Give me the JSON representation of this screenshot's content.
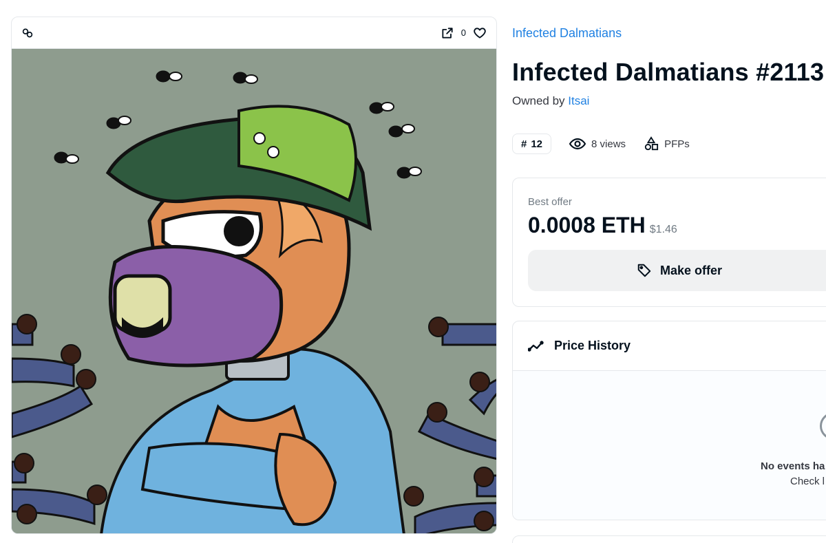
{
  "media": {
    "chain_icon": "chain-link-icon",
    "external_icon": "external-link-icon",
    "favorite_icon": "heart-icon",
    "favorite_count": "0",
    "background_color": "#8e9c8e"
  },
  "item": {
    "collection": "Infected Dalmatians",
    "title": "Infected Dalmatians #2113",
    "owned_prefix": "Owned by",
    "owner": "Itsai"
  },
  "meta": {
    "rank_symbol": "#",
    "rank": "12",
    "views": "8 views",
    "category": "PFPs"
  },
  "offer": {
    "label": "Best offer",
    "price": "0.0008 ETH",
    "usd": "$1.46",
    "button_label": "Make offer"
  },
  "history": {
    "title": "Price History",
    "empty_title": "No events ha",
    "empty_sub": "Check l"
  },
  "colors": {
    "link": "#2081e2",
    "text": "#04111d",
    "muted": "#707a83",
    "border": "#e5e8eb"
  }
}
